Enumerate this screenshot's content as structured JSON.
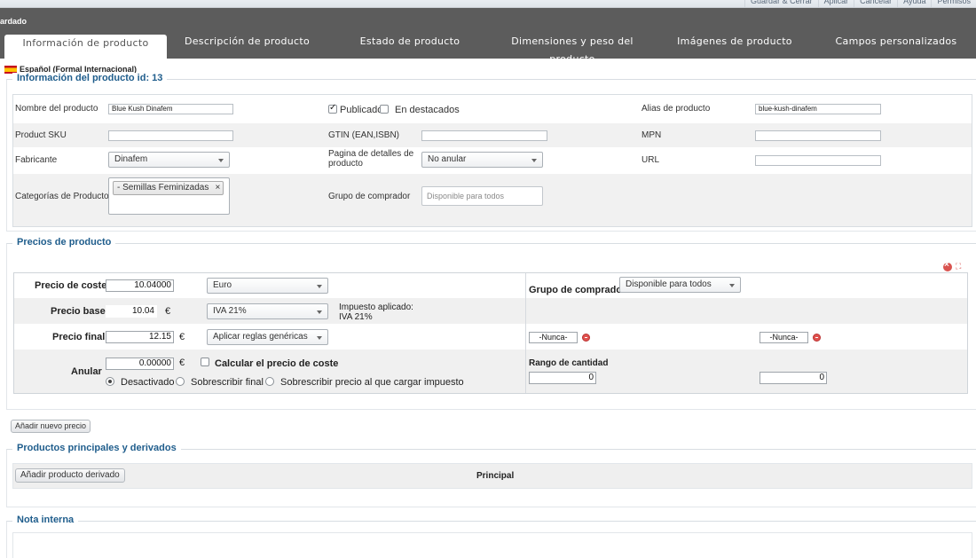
{
  "toolbar": {
    "save_close": "Guardar & Cerrar",
    "apply": "Aplicar",
    "cancel": "Cancelar",
    "help": "Ayuda",
    "permissions": "Permisos"
  },
  "saved_label": "ardado",
  "tabs": [
    {
      "label": "Información de producto",
      "active": true
    },
    {
      "label": "Descripción de producto",
      "active": false
    },
    {
      "label": "Estado de producto",
      "active": false
    },
    {
      "label": "Dimensiones y peso del producto",
      "active": false
    },
    {
      "label": "Imágenes de producto",
      "active": false
    },
    {
      "label": "Campos personalizados",
      "active": false
    }
  ],
  "language": "Español (Formal Internacional)",
  "info": {
    "legend": "Información del producto id: 13",
    "name_label": "Nombre del producto",
    "name_value": "Blue Kush Dinafem",
    "published_label": "Publicado",
    "published_checked": true,
    "featured_label": "En destacados",
    "featured_checked": false,
    "alias_label": "Alias de producto",
    "alias_value": "blue-kush-dinafem",
    "sku_label": "Product SKU",
    "sku_value": "",
    "gtin_label": "GTIN (EAN,ISBN)",
    "gtin_value": "",
    "mpn_label": "MPN",
    "mpn_value": "",
    "manufacturer_label": "Fabricante",
    "manufacturer_value": "Dinafem",
    "details_page_label_1": "Pagina de detalles de",
    "details_page_label_2": "producto",
    "details_page_value": "No anular",
    "url_label": "URL",
    "url_value": "",
    "categories_label": "Categorías de Producto",
    "category_tag": "- Semillas Feminizadas",
    "tag_remove": "×",
    "buyer_group_label": "Grupo de comprador",
    "buyer_group_placeholder": "Disponible para todos"
  },
  "prices": {
    "legend": "Precios de producto",
    "cost_label": "Precio de coste",
    "cost_value": "10.04000",
    "currency": "Euro",
    "buyer_group_label": "Grupo de comprador",
    "buyer_group_value": "Disponible para todos",
    "base_label": "Precio base",
    "base_value": "10.04",
    "euro_sign": "€",
    "tax_value": "IVA 21%",
    "tax_applied_label": "Impuesto aplicado:",
    "tax_applied_value": "IVA 21%",
    "final_label": "Precio final",
    "final_value": "12.15",
    "rules_value": "Aplicar reglas genéricas",
    "never_from": "-Nunca-",
    "never_to": "-Nunca-",
    "override_label": "Anular",
    "override_value": "0.00000",
    "calc_cost_label": "Calcular el precio de coste",
    "radio_disabled": "Desactivado",
    "radio_overwrite_final": "Sobrescribir final",
    "radio_overwrite_tax": "Sobrescribir precio al que cargar impuesto",
    "qty_range_label": "Rango de cantidad",
    "qty_from": "0",
    "qty_to": "0",
    "add_price_button": "Añadir nuevo precio"
  },
  "derived": {
    "legend": "Productos principales y derivados",
    "add_button": "Añadir producto derivado",
    "principal_label": "Principal"
  },
  "note": {
    "legend": "Nota interna"
  }
}
